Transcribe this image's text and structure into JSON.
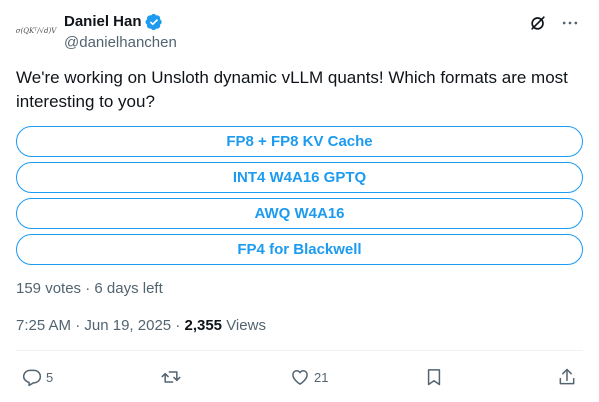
{
  "author": {
    "avatar_text": "σ(QKᵀ/√d)V",
    "name": "Daniel Han",
    "handle": "@danielhanchen",
    "verified": true
  },
  "top_actions": {
    "icons": [
      "grok-icon",
      "more-icon"
    ]
  },
  "tweet": {
    "text": "We're working on Unsloth dynamic vLLM quants! Which formats are most interesting to you?"
  },
  "poll": {
    "options": [
      {
        "label": "FP8 + FP8 KV Cache"
      },
      {
        "label": "INT4 W4A16 GPTQ"
      },
      {
        "label": "AWQ W4A16"
      },
      {
        "label": "FP4 for Blackwell"
      }
    ],
    "meta": "159 votes · 6 days left"
  },
  "timestamp": {
    "time": "7:25 AM",
    "separator1": " · ",
    "date": "Jun 19, 2025",
    "separator2": " · ",
    "views_count": "2,355",
    "views_label": " Views"
  },
  "actions": {
    "reply_count": "5",
    "retweet_count": "",
    "like_count": "21"
  },
  "colors": {
    "accent": "#1d9bf0",
    "text": "#0f1419",
    "secondary": "#536471"
  }
}
